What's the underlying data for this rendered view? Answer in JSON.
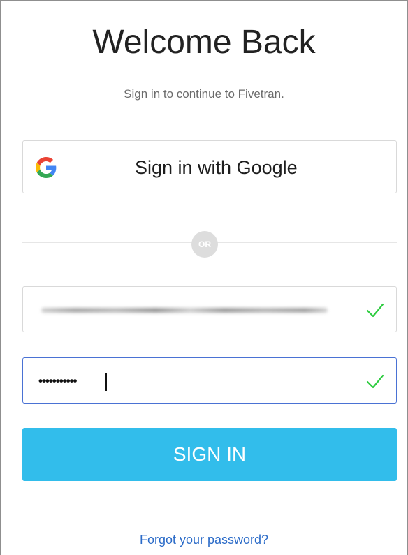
{
  "header": {
    "title": "Welcome Back",
    "subtitle": "Sign in to continue to Fivetran."
  },
  "google": {
    "label": "Sign in with Google",
    "icon": "google-icon"
  },
  "divider": {
    "label": "OR"
  },
  "email_field": {
    "value_obscured": true,
    "valid_icon": "check-icon"
  },
  "password_field": {
    "value": "•••••••••••",
    "valid_icon": "check-icon"
  },
  "submit": {
    "label": "SIGN IN"
  },
  "forgot": {
    "label": "Forgot your password?"
  },
  "colors": {
    "primary": "#32bdeb",
    "link": "#2b6bc8",
    "valid": "#2ecc40",
    "focus_border": "#4a72d4"
  }
}
